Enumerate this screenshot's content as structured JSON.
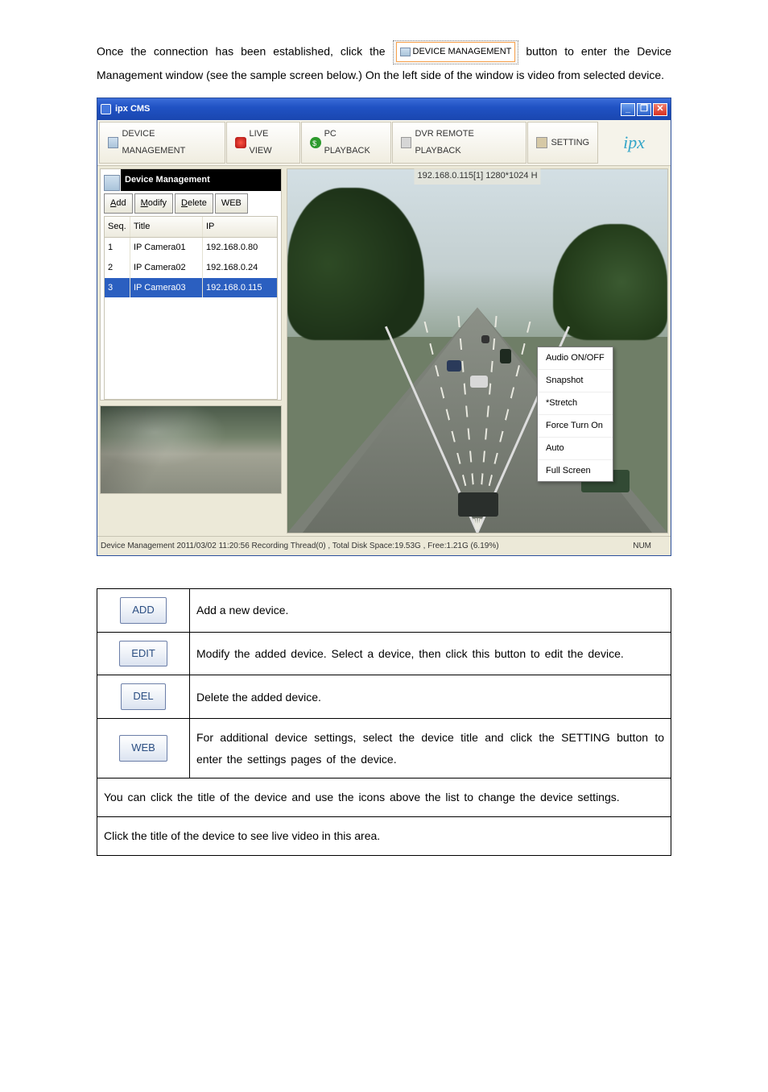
{
  "intro": {
    "p1a": "Once the connection has been established, click the ",
    "inlineBtn": "DEVICE MANAGEMENT",
    "p1b": " button to enter the Device Management window (see the sample screen below.) On the left side of the window is video from selected device."
  },
  "window": {
    "title": "ipx CMS",
    "tabs": {
      "dm": "DEVICE MANAGEMENT",
      "live": "LIVE VIEW",
      "pc": "PC PLAYBACK",
      "dvr": "DVR REMOTE PLAYBACK",
      "setting": "SETTING"
    },
    "brand": "ipx",
    "dm": {
      "header": "Device Management",
      "buttons": {
        "add": "Add",
        "modify": "Modify",
        "delete": "Delete",
        "web": "WEB"
      },
      "cols": {
        "seq": "Seq.",
        "title": "Title",
        "ip": "IP"
      },
      "rows": [
        {
          "seq": "1",
          "title": "IP Camera01",
          "ip": "192.168.0.80"
        },
        {
          "seq": "2",
          "title": "IP Camera02",
          "ip": "192.168.0.24"
        },
        {
          "seq": "3",
          "title": "IP Camera03",
          "ip": "192.168.0.115"
        }
      ],
      "selectedIndex": 2
    },
    "videoCaption": "192.168.0.115[1] 1280*1024 H",
    "contextMenu": {
      "items": [
        "Audio ON/OFF",
        "Snapshot",
        "*Stretch",
        "Force Turn On",
        "Auto",
        "Full Screen"
      ]
    },
    "status": {
      "left": "Device Management  2011/03/02 11:20:56  Recording Thread(0) , Total Disk Space:19.53G , Free:1.21G (6.19%)",
      "right": "NUM"
    }
  },
  "btns": {
    "add": {
      "label": "ADD",
      "desc": "Add a new device."
    },
    "edit": {
      "label": "EDIT",
      "desc": "Modify the added device. Select a device, then click this button to edit the device."
    },
    "del": {
      "label": "DEL",
      "desc": "Delete the added device."
    },
    "web": {
      "label": "WEB",
      "desc": "For additional device settings, select the device title and click the SETTING button to enter the settings pages of the device."
    }
  },
  "notes": {
    "n1": "You can click the title of the device and use the icons above the list to change the device settings.",
    "n2": "Click the title of the device to see live video in this area."
  }
}
